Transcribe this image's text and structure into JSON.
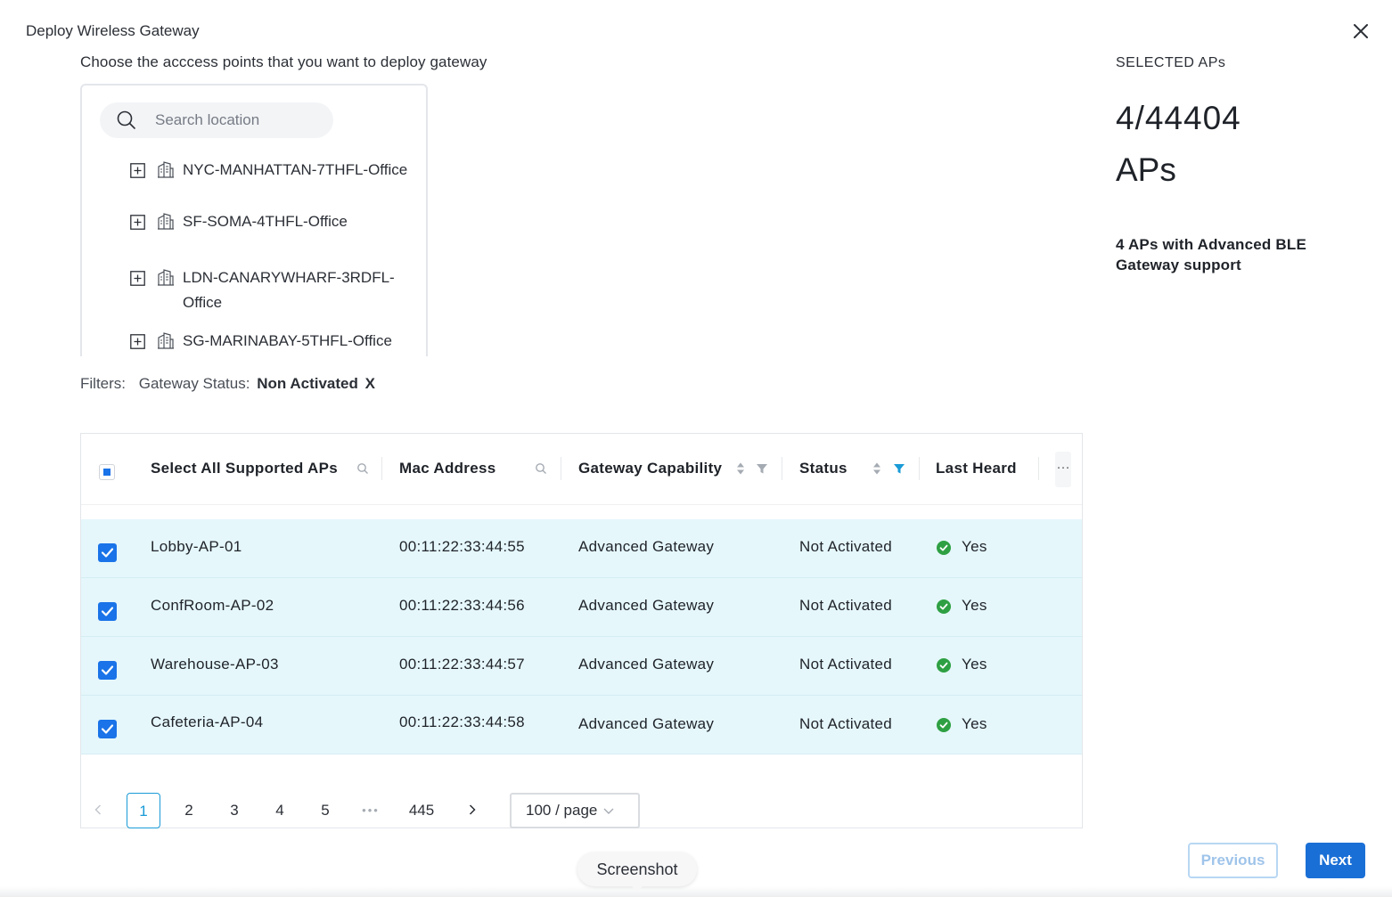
{
  "dialog": {
    "title": "Deploy Wireless Gateway",
    "instructions": "Choose the acccess points that you want to deploy gateway"
  },
  "tree": {
    "search_placeholder": "Search location",
    "items": [
      {
        "line1": "NYC-MANHATTAN-7THFL-Office",
        "line2": ""
      },
      {
        "line1": "SF-SOMA-4THFL-Office",
        "line2": ""
      },
      {
        "line1": "LDN-CANARYWHARF-3RDFL-",
        "line2": "Office"
      },
      {
        "line1": "SG-MARINABAY-5THFL-Office",
        "line2": ""
      }
    ]
  },
  "filters": {
    "label": "Filters:",
    "field": "Gateway Status:",
    "value": "Non Activated",
    "remove": "X"
  },
  "table": {
    "columns": {
      "name": "Select All Supported APs",
      "mac": "Mac Address",
      "capability": "Gateway Capability",
      "status": "Status",
      "last_heard": "Last Heard",
      "more": "···"
    },
    "rows": [
      {
        "name": "Lobby-AP-01",
        "mac": "00:11:22:33:44:55",
        "capability": "Advanced Gateway",
        "status": "Not Activated",
        "last_heard": "Yes",
        "checked": true
      },
      {
        "name": "ConfRoom-AP-02",
        "mac": "00:11:22:33:44:56",
        "capability": "Advanced Gateway",
        "status": "Not Activated",
        "last_heard": "Yes",
        "checked": true
      },
      {
        "name": "Warehouse-AP-03",
        "mac": "00:11:22:33:44:57",
        "capability": "Advanced Gateway",
        "status": "Not Activated",
        "last_heard": "Yes",
        "checked": true
      },
      {
        "name": "Cafeteria-AP-04",
        "mac": "00:11:22:33:44:58",
        "capability": "Advanced Gateway",
        "status": "Not Activated",
        "last_heard": "Yes",
        "checked": true
      }
    ]
  },
  "pagination": {
    "pages": [
      "1",
      "2",
      "3",
      "4",
      "5"
    ],
    "ellipsis": "•••",
    "last": "445",
    "current": "1",
    "page_size": "100 / page"
  },
  "summary": {
    "label": "SELECTED APs",
    "count": "4/44404",
    "unit": "APs",
    "note": "4 APs with Advanced BLE Gateway support"
  },
  "footer": {
    "previous": "Previous",
    "next": "Next",
    "screenshot": "Screenshot"
  },
  "colors": {
    "accent": "#1a73e8",
    "row_selected": "#e5f7fb",
    "success": "#2ea043",
    "filter_active": "#1a9bd7"
  }
}
